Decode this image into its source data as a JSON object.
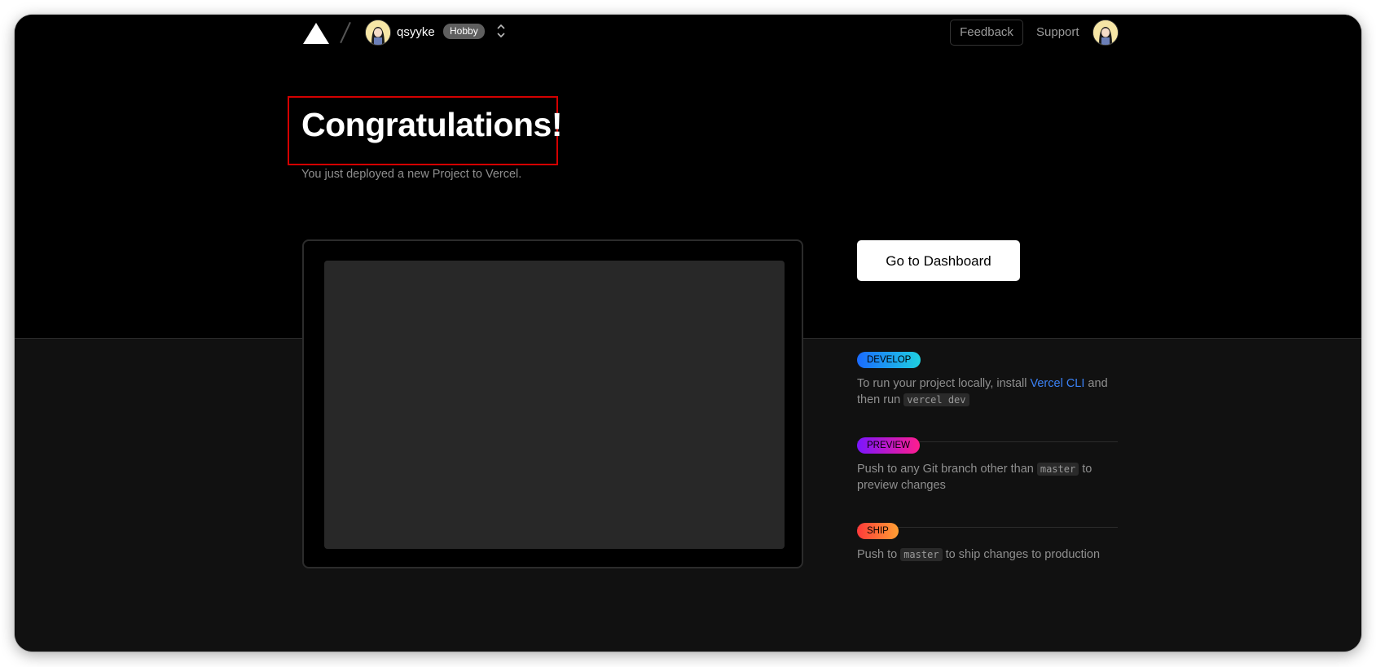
{
  "header": {
    "team_name": "qsyyke",
    "plan_badge": "Hobby",
    "feedback_label": "Feedback",
    "support_label": "Support",
    "switcher_icon": "chevron-up-down-icon"
  },
  "hero": {
    "title": "Congratulations!",
    "subtitle": "You just deployed a new Project to Vercel."
  },
  "actions": {
    "dashboard_label": "Go to Dashboard"
  },
  "steps": [
    {
      "badge": "DEVELOP",
      "text_before": "To run your project locally, install ",
      "link": "Vercel CLI",
      "text_middle": " and then run ",
      "code": "vercel dev",
      "text_after": ""
    },
    {
      "badge": "PREVIEW",
      "text_before": "Push to any Git branch other than ",
      "code": "master",
      "text_after": " to preview changes"
    },
    {
      "badge": "SHIP",
      "text_before": "Push to ",
      "code": "master",
      "text_after": " to ship changes to production"
    }
  ],
  "colors": {
    "background": "#000000",
    "lower_background": "#111111",
    "highlight_box": "#d40000",
    "link": "#3b82f6"
  }
}
